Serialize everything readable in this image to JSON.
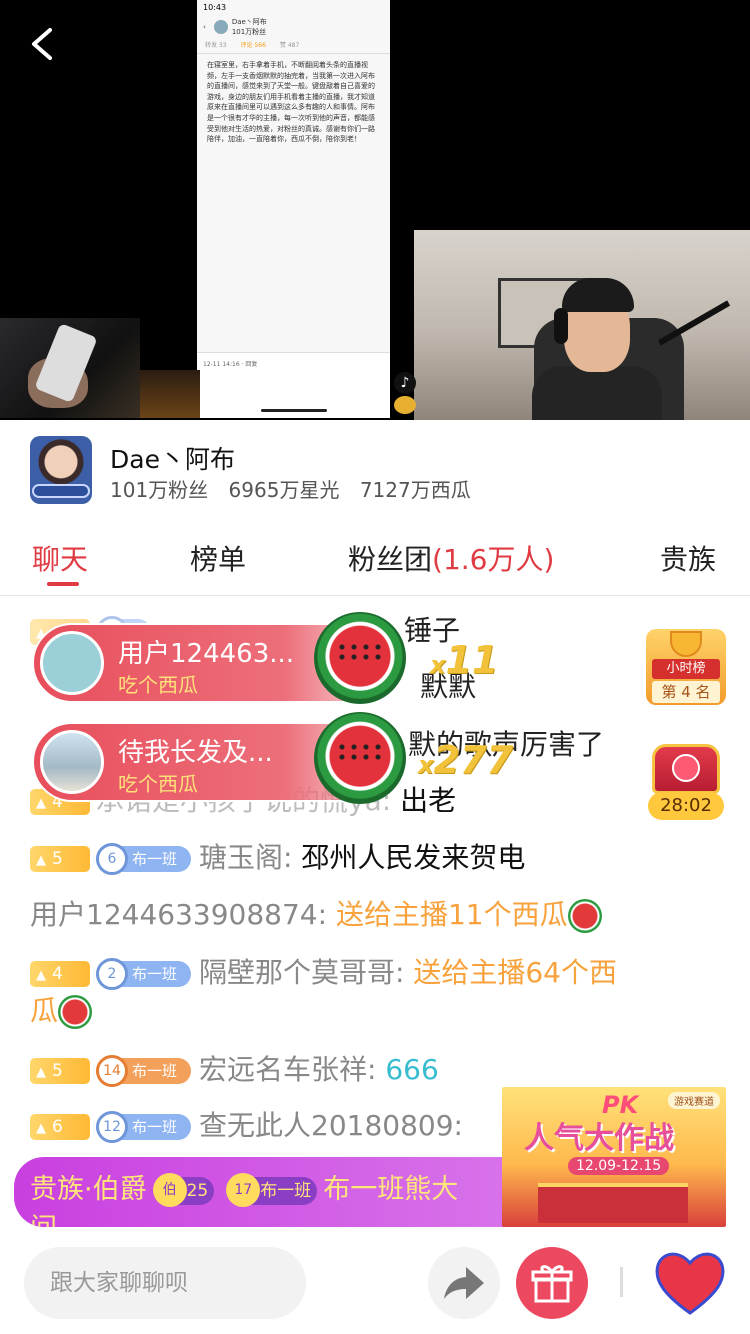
{
  "video": {
    "phone_time": "10:43",
    "phone_title": "Dae丶阿布",
    "phone_subtitle": "101万粉丝",
    "phone_tabs": [
      "转发 33",
      "评论 566",
      "赞 487"
    ],
    "phone_text": "在寝室里，右手拿着手机，不断翻阅着头条的直播视频，左手一支香烟默默的抽完着，当我第一次进入阿布的直播间，感觉来到了天堂一般。键盘敲着自己喜爱的游戏，身边的朋友们用手机看着主播的直播，我才知道原来在直播间里可以遇到这么多有趣的人和事情。阿布是一个很有才华的主播，每一次听到他的声音，都能感受到他对生活的热爱，对粉丝的真诚。感谢有你们一路陪伴，加油，一直陪着你，西瓜不倒，陪你到老！",
    "phone_footer": "12-11 14:16 · 回复",
    "tiktok_icon": "♪"
  },
  "streamer": {
    "name": "Dae丶阿布",
    "fans": "101万粉丝",
    "stars": "6965万星光",
    "melons": "7127万西瓜"
  },
  "tabs": {
    "chat": "聊天",
    "rank": "榜单",
    "fan_club_prefix": "粉丝团",
    "fan_club_count": "(1.6万人)",
    "noble": "贵族"
  },
  "chat": {
    "msg1": {
      "text": "锤子"
    },
    "msg2": {
      "text": "默默"
    },
    "msg3": {
      "text": "默的歌声厉害了"
    },
    "msg4": {
      "level": "4",
      "user": "承诺是小孩子说的慌ya:",
      "text": "出老"
    },
    "msg5": {
      "level": "5",
      "badge_num": "6",
      "badge": "布一班",
      "user": "瑭玉阁:",
      "text": "邳州人民发来贺电"
    },
    "msg6": {
      "user": "用户1244633908874:",
      "text": "送给主播11个西瓜"
    },
    "msg7": {
      "level": "4",
      "badge_num": "2",
      "badge": "布一班",
      "user": "隔壁那个莫哥哥:",
      "text": "送给主播64个西",
      "text2": "瓜"
    },
    "msg8": {
      "level": "5",
      "badge_num": "14",
      "badge": "布一班",
      "user": "宏远名车张祥:",
      "text": "666"
    },
    "msg9": {
      "level": "6",
      "badge_num": "12",
      "badge": "布一班",
      "user": "查无此人20180809:"
    }
  },
  "gifts": [
    {
      "user": "用户124463...",
      "action": "吃个西瓜",
      "combo_x": "x",
      "combo": "11"
    },
    {
      "user": "待我长发及...",
      "action": "吃个西瓜",
      "combo_x": "x",
      "combo": "277"
    }
  ],
  "widgets": {
    "hour_rank_label": "小时榜",
    "hour_rank_pos": "第 4 名",
    "chest_timer": "28:02",
    "pk_tag": "游戏赛道",
    "pk_logo": "PK",
    "pk_title": "人气大作战",
    "pk_dates": "12.09-12.15"
  },
  "noble_bar": {
    "title": "贵族·伯爵",
    "rank_icon": "伯",
    "rank_level": "25",
    "badge_num": "17",
    "badge": "布一班",
    "name": "布一班熊大",
    "line2": "间"
  },
  "bottom": {
    "input_placeholder": "跟大家聊聊呗"
  },
  "colors": {
    "accent_red": "#e03a43",
    "gift_orange": "#f7a23c",
    "teal_text": "#37bcd0",
    "noble_purple": "#c93fe0"
  }
}
